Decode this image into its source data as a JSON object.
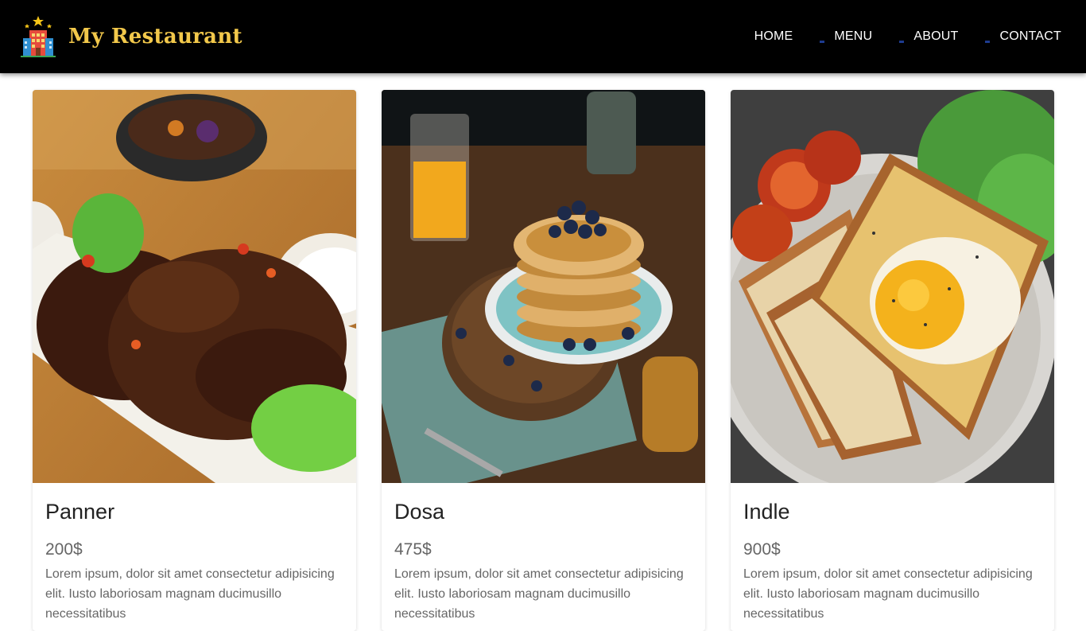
{
  "brand": {
    "name": "My Restaurant"
  },
  "nav": {
    "items": [
      {
        "label": "HOME"
      },
      {
        "label": "MENU"
      },
      {
        "label": "ABOUT"
      },
      {
        "label": "CONTACT"
      }
    ]
  },
  "colors": {
    "navbar": "#000000",
    "brand_text": "#f2c84b",
    "nav_text": "#ffffff"
  },
  "cards": [
    {
      "title": "Panner",
      "price": "200$",
      "description": "Lorem ipsum, dolor sit amet consectetur adipisicing elit. Iusto laboriosam magnam ducimusillo necessitatibus",
      "image_icon": "grilled-meat-plate-photo"
    },
    {
      "title": "Dosa",
      "price": "475$",
      "description": "Lorem ipsum, dolor sit amet consectetur adipisicing elit. Iusto laboriosam magnam ducimusillo necessitatibus",
      "image_icon": "blueberry-pancakes-photo"
    },
    {
      "title": "Indle",
      "price": "900$",
      "description": "Lorem ipsum, dolor sit amet consectetur adipisicing elit. Iusto laboriosam magnam ducimusillo necessitatibus",
      "image_icon": "egg-toast-breakfast-photo"
    }
  ]
}
